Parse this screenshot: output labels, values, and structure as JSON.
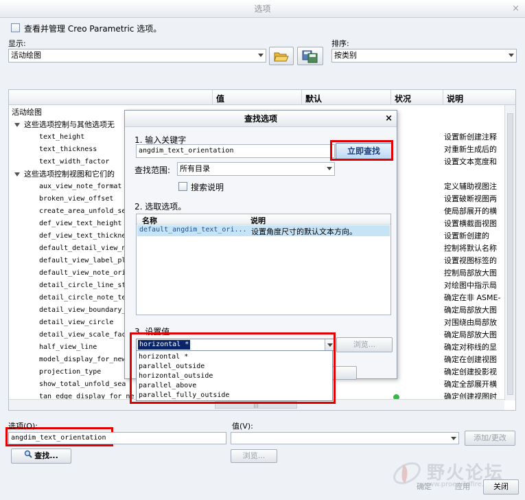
{
  "window": {
    "title": "选项",
    "close": "×"
  },
  "manage": {
    "label": "查看并管理 Creo Parametric 选项。"
  },
  "display": {
    "label": "显示:",
    "value": "活动绘图"
  },
  "sort": {
    "label": "排序:",
    "value": "按类别"
  },
  "table": {
    "headers": [
      "值",
      "默认",
      "状况",
      "说明"
    ],
    "group_root": "活动绘图",
    "group1": "这些选项控制与其他选项无",
    "group2": "这些选项控制视图和它们的",
    "rows": [
      {
        "name": "text_height",
        "desc": "设置新创建注释"
      },
      {
        "name": "text_thickness",
        "desc": "对重新生成后的"
      },
      {
        "name": "text_width_factor",
        "desc": "设置文本宽度和"
      },
      {
        "name": "aux_view_note_format",
        "desc": "定义辅助视图注"
      },
      {
        "name": "broken_view_offset",
        "desc": "设置破断视图两"
      },
      {
        "name": "create_area_unfold_se",
        "desc": "使局部展开的横"
      },
      {
        "name": "def_view_text_height",
        "desc": "设置横截面视图"
      },
      {
        "name": "def_view_text_thickne",
        "desc": "设置新创建的"
      },
      {
        "name": "default_detail_view_n",
        "desc": "控制将默认名称"
      },
      {
        "name": "default_view_label_pl",
        "desc": "设置视图标签的"
      },
      {
        "name": "default_view_note_ori",
        "desc": "控制局部放大图"
      },
      {
        "name": "detail_circle_line_st",
        "desc": "对绘图中指示局"
      },
      {
        "name": "detail_circle_note_te",
        "desc": "确定在非 ASME-"
      },
      {
        "name": "detail_view_boundary_",
        "desc": "确定局部放大图"
      },
      {
        "name": "detail_view_circle",
        "desc": "对围绕由局部放"
      },
      {
        "name": "detail_view_scale_fac",
        "desc": "确定局部放大图"
      },
      {
        "name": "half_view_line",
        "desc": "确定对称线的显"
      },
      {
        "name": "model_display_for_new",
        "desc": "确定在创建视图"
      },
      {
        "name": "projection_type",
        "desc": "确定创建投影视"
      },
      {
        "name": "show_total_unfold_sea",
        "desc": "确定全部展开横"
      },
      {
        "name": "tan_edge_display_for_ne",
        "desc": "确定创建视图时"
      }
    ],
    "hscroll_grip": "|||"
  },
  "find_dialog": {
    "title": "查找选项",
    "close": "×",
    "step1": "1.  输入关键字",
    "keyword": "angdim_text_orientation",
    "search_now": "立即查找",
    "scope_label": "查找范围:",
    "scope_value": "所有目录",
    "search_desc_label": "搜索说明",
    "step2": "2.  选取选项。",
    "list_headers": [
      "名称",
      "说明"
    ],
    "result_name": "default_angdim_text_ori...",
    "result_desc": "设置角度尺寸的默认文本方向。",
    "step3": "3.  设置值",
    "set_value": "horizontal *",
    "browse": "浏览..."
  },
  "dropdown_options": [
    "horizontal *",
    "parallel_outside",
    "horizontal_outside",
    "parallel_above",
    "parallel_fully_outside"
  ],
  "bottom": {
    "option_label": "选项(O):",
    "option_value": "angdim_text_orientation",
    "value_label": "值(V):",
    "add_change": "添加/更改",
    "find": "查找...",
    "browse": "浏览...",
    "ok": "确定",
    "apply": "应用",
    "close": "关闭"
  },
  "watermark": {
    "text": "野火论坛",
    "url": "www.proewildfire.cn"
  },
  "colors": {
    "highlight": "#e00000",
    "selection": "#c7e4f7",
    "dropdown_selection": "#0a246a"
  }
}
